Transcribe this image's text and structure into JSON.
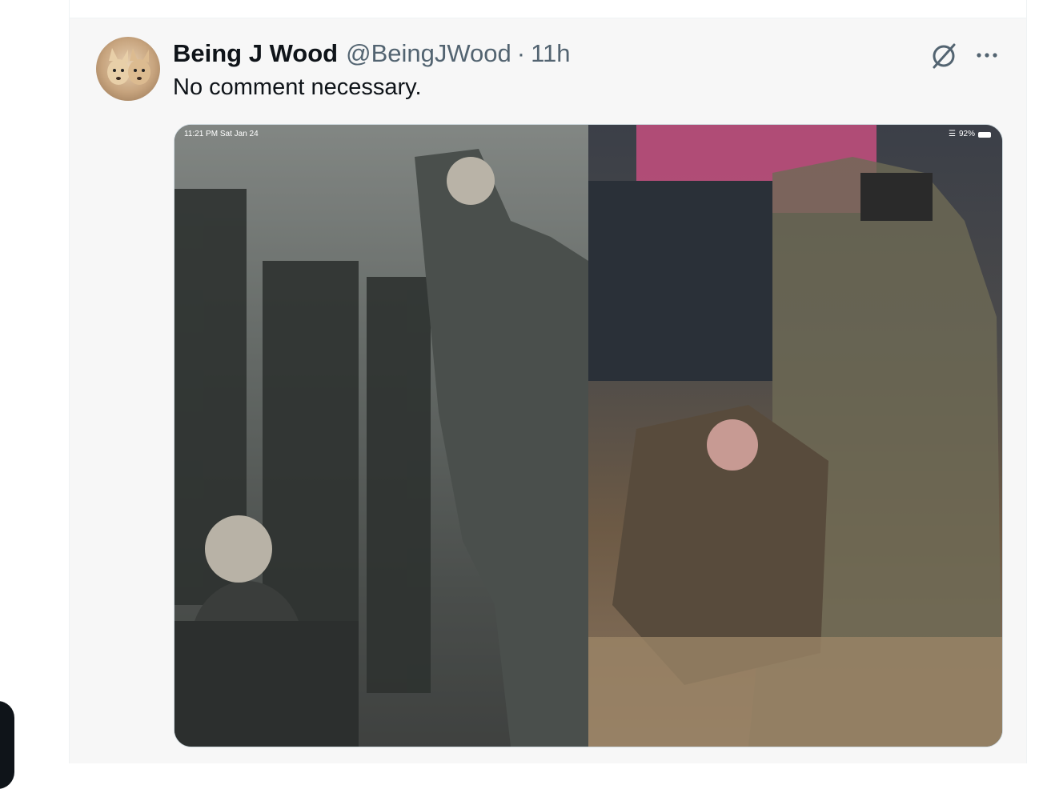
{
  "tweet": {
    "display_name": "Being J Wood",
    "handle": "@BeingJWood",
    "separator": "·",
    "time": "11h",
    "text": "No comment necessary.",
    "avatar_icon": "avatar-dogs",
    "grok_icon": "grok-icon",
    "more_icon": "more-icon"
  },
  "media": {
    "status_time": "11:21 PM   Sat Jan 24",
    "battery": "92%"
  },
  "colors": {
    "text_primary": "#0f1419",
    "text_secondary": "#536471",
    "tweet_bg": "#f7f7f7",
    "border": "#eff3f4"
  }
}
